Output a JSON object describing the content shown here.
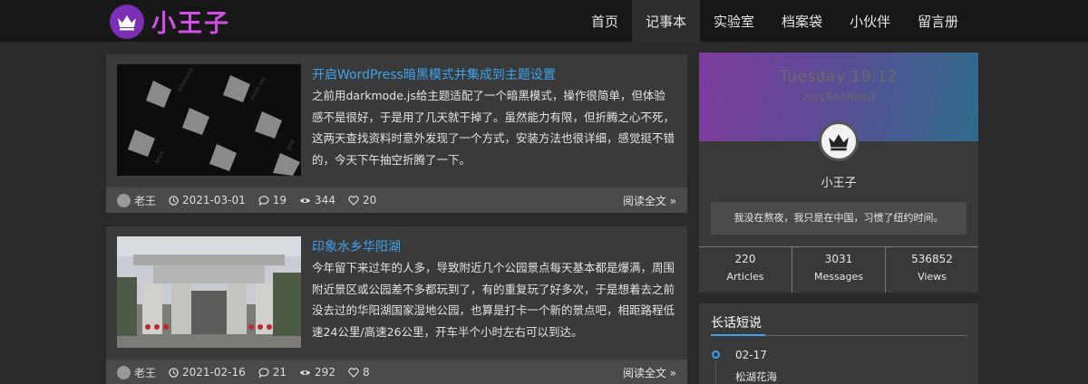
{
  "brand": {
    "name": "小王子",
    "logo_icon": "crown-icon"
  },
  "nav": [
    {
      "label": "首页"
    },
    {
      "label": "记事本",
      "active": true
    },
    {
      "label": "实验室"
    },
    {
      "label": "档案袋"
    },
    {
      "label": "小伙伴"
    },
    {
      "label": "留言册"
    }
  ],
  "posts": [
    {
      "title": "开启WordPress暗黑模式并集成到主题设置",
      "excerpt": "之前用darkmode.js给主题适配了一个暗黑模式，操作很简单，但体验感不是很好，于是用了几天就干掉了。虽然能力有限，但折腾之心不死，这两天查找资料时意外发现了一个方式，安装方法也很详细，感觉挺不错的，今天下午抽空折腾了一下。",
      "author": "老王",
      "date": "2021-03-01",
      "comments": "19",
      "views": "344",
      "likes": "20",
      "read_more": "阅读全文 »"
    },
    {
      "title": "印象水乡华阳湖",
      "excerpt": "今年留下来过年的人多，导致附近几个公园景点每天基本都是爆满，周围附近景区或公园差不多都玩到了，有的重复玩了好多次，于是想着去之前没去过的华阳湖国家湿地公园，也算是打卡一个新的景点吧，相距路程低速24公里/高速26公里，开车半个小时左右可以到达。",
      "author": "老王",
      "date": "2021-02-16",
      "comments": "21",
      "views": "292",
      "likes": "8",
      "read_more": "阅读全文 »"
    }
  ],
  "profile": {
    "clock": "Tuesday 19:12",
    "date": "2021年03月09日",
    "name": "小王子",
    "bio": "我没在熬夜，我只是在中国，习惯了纽约时间。",
    "stats": [
      {
        "value": "220",
        "label": "Articles"
      },
      {
        "value": "3031",
        "label": "Messages"
      },
      {
        "value": "536852",
        "label": "Views"
      }
    ]
  },
  "talk": {
    "title": "长话短说",
    "items": [
      {
        "date": "02-17",
        "text": "松湖花海"
      }
    ]
  },
  "colors": {
    "accent": "#3aa3ee",
    "brand": "#d24fe6",
    "background": "#2a2a2a",
    "card": "#3a3a3a"
  }
}
